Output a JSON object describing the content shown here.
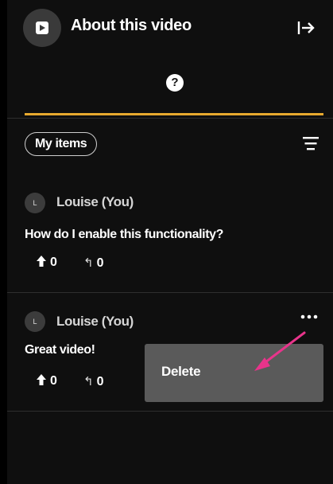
{
  "header": {
    "title": "About this video",
    "play_icon": "play-icon",
    "exit_icon": "exit-panel-icon"
  },
  "tabs": {
    "active_icon": "?",
    "accent": "#e8a92f"
  },
  "filters": {
    "chip_label": "My items",
    "filter_icon": "filter-icon"
  },
  "posts": [
    {
      "avatar": "L",
      "author": "Louise (You)",
      "text": "How do I enable this functionality?",
      "upvotes": "0",
      "replies": "0"
    },
    {
      "avatar": "L",
      "author": "Louise (You)",
      "text": "Great video!",
      "upvotes": "0",
      "replies": "0"
    }
  ],
  "context_menu": {
    "items": [
      "Delete"
    ],
    "background": "#5a5a5a"
  },
  "annotation": {
    "arrow_color": "#e8348b"
  }
}
